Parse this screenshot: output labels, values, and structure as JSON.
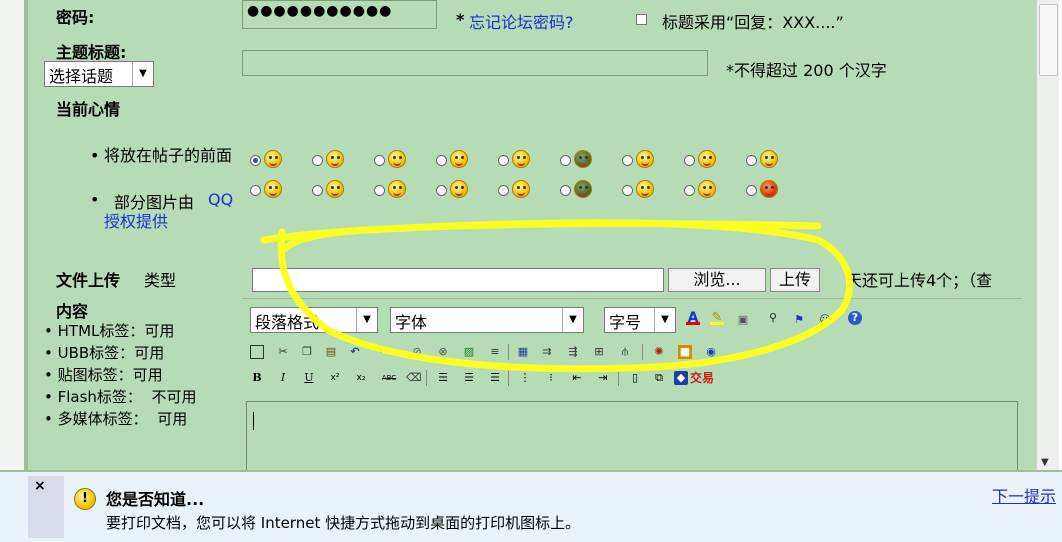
{
  "password": {
    "label": "密码:",
    "mask": "●●●●●●●●●●●",
    "forgot_star": "*",
    "forgot_link": "忘记论坛密码?",
    "reply_title_option": "标题采用“回复：XXX....”"
  },
  "subject": {
    "label": "主题标题:",
    "topic_select": "选择话题",
    "value": "",
    "hint": "*不得超过 200 个汉字"
  },
  "mood": {
    "label": "当前心情",
    "notes": [
      "将放在帖子的前面",
      "部分图片由"
    ],
    "qq_link": "QQ授权提供",
    "emoticons_row1": [
      "smile",
      "blush",
      "happy",
      "love-eyes",
      "tongue",
      "turtle",
      "surprised",
      "wink",
      "question"
    ],
    "emoticons_row2": [
      "confused",
      "angry",
      "crying",
      "shocked",
      "smirk",
      "cool",
      "sad",
      "hammer",
      "mad"
    ],
    "selected_index": 0
  },
  "upload": {
    "label": "文件上传",
    "type_label": "类型",
    "browse_button": "浏览...",
    "upload_button": "上传",
    "remaining_text": "天还可上传4个；（查"
  },
  "content": {
    "label": "内容",
    "rules": [
      {
        "name": "HTML标签：",
        "value": "可用"
      },
      {
        "name": "UBB标签：",
        "value": "可用"
      },
      {
        "name": "贴图标签：",
        "value": "可用"
      },
      {
        "name": "Flash标签：",
        "value": "不可用"
      },
      {
        "name": "多媒体标签：",
        "value": "可用"
      }
    ],
    "editor": {
      "paragraph_select": "段落格式",
      "font_select": "字体",
      "size_select": "字号",
      "trade_label": "交易",
      "body": ""
    }
  },
  "tip": {
    "title": "您是否知道...",
    "text": "要打印文档，您可以将 Internet 快捷方式拖动到桌面的打印机图标上。",
    "next_link": "下一提示",
    "close_glyph": "×"
  },
  "colors": {
    "form_bg": "#b6dcb6",
    "link": "#1a2fd6",
    "highlight_scribble": "#ffff1a"
  }
}
